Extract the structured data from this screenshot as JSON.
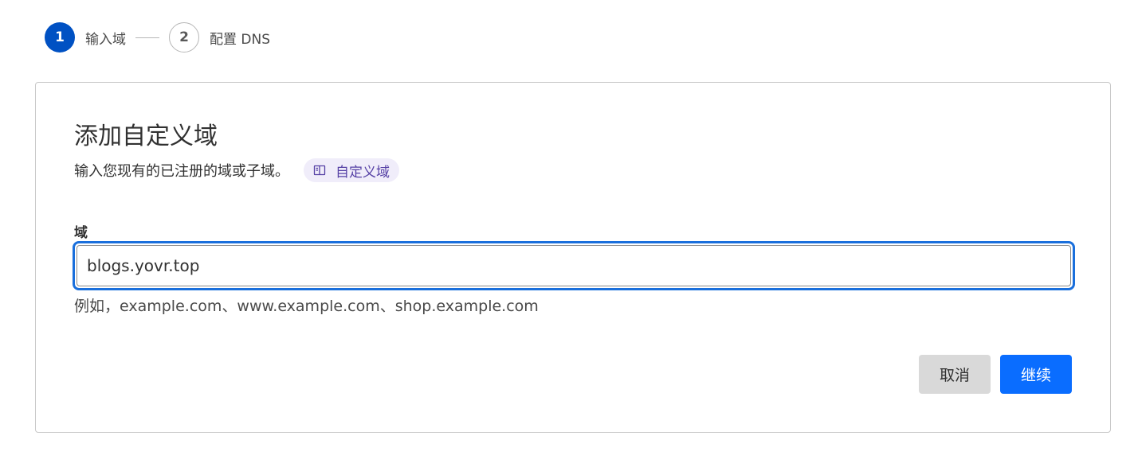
{
  "stepper": {
    "steps": [
      {
        "number": "1",
        "label": "输入域",
        "state": "active"
      },
      {
        "number": "2",
        "label": "配置 DNS",
        "state": "inactive"
      }
    ]
  },
  "card": {
    "title": "添加自定义域",
    "subtitle": "输入您现有的已注册的域或子域。",
    "doc_link": {
      "label": "自定义域",
      "icon": "book-icon"
    }
  },
  "domain_field": {
    "label": "域",
    "value": "blogs.yovr.top",
    "hint": "例如，example.com、www.example.com、shop.example.com"
  },
  "actions": {
    "cancel_label": "取消",
    "continue_label": "继续"
  },
  "colors": {
    "primary": "#0a6dff",
    "step_active": "#0051c3",
    "focus_ring": "#1a6fdc",
    "chip_bg": "#f0edfa",
    "chip_text": "#5540a5"
  }
}
